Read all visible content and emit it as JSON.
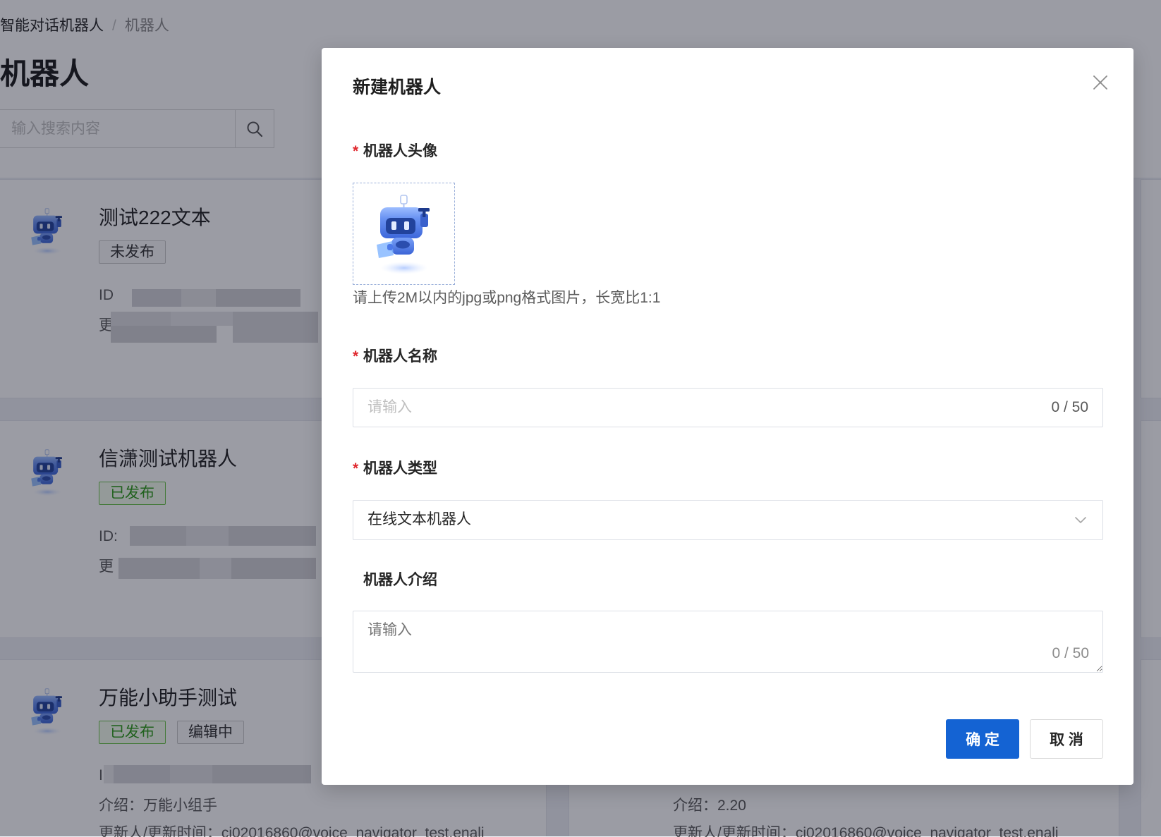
{
  "page": {
    "breadcrumb": {
      "items": [
        "智能对话机器人",
        "机器人"
      ],
      "separator": "/"
    },
    "title": "机器人",
    "search": {
      "placeholder": "输入搜索内容",
      "value": "",
      "icon": "search-icon"
    },
    "cards": [
      {
        "name": "测试222文本",
        "avatar": "robot-avatar",
        "tags": [
          {
            "label": "未发布",
            "status": "unpublished"
          }
        ],
        "lines": [
          "ID",
          "更"
        ]
      },
      {
        "name": "信潇测试机器人",
        "avatar": "robot-avatar",
        "tags": [
          {
            "label": "已发布",
            "status": "published"
          }
        ],
        "lines": [
          "ID:",
          "更"
        ]
      },
      {
        "name": "万能小助手测试",
        "avatar": "robot-avatar",
        "tags": [
          {
            "label": "已发布",
            "status": "published"
          },
          {
            "label": "编辑中",
            "status": "editing"
          }
        ],
        "lines": [
          "I",
          "介绍：万能小组手",
          "更新人/更新时间：cj02016860@voice_navigator_test.enali"
        ]
      },
      {
        "lines": [
          "介绍：2.20",
          "更新人/更新时间：cj02016860@voice_navigator_test.enali"
        ]
      }
    ]
  },
  "modal": {
    "title": "新建机器人",
    "close_icon": "close-icon",
    "required_mark": "*",
    "fields": {
      "avatar": {
        "label": "机器人头像",
        "required": true,
        "image": "robot-avatar",
        "hint": "请上传2M以内的jpg或png格式图片，长宽比1:1"
      },
      "name": {
        "label": "机器人名称",
        "required": true,
        "placeholder": "请输入",
        "value": "",
        "counter": "0 / 50"
      },
      "type": {
        "label": "机器人类型",
        "required": true,
        "value": "在线文本机器人",
        "icon": "chevron-down-icon"
      },
      "intro": {
        "label": "机器人介绍",
        "required": false,
        "placeholder": "请输入",
        "value": "",
        "counter": "0 / 50"
      }
    },
    "buttons": {
      "ok": "确 定",
      "cancel": "取 消"
    }
  },
  "colors": {
    "primary": "#1463d3",
    "required": "#e0282e",
    "published": "#2b9a18",
    "robot_blue": "#5a86ee"
  }
}
